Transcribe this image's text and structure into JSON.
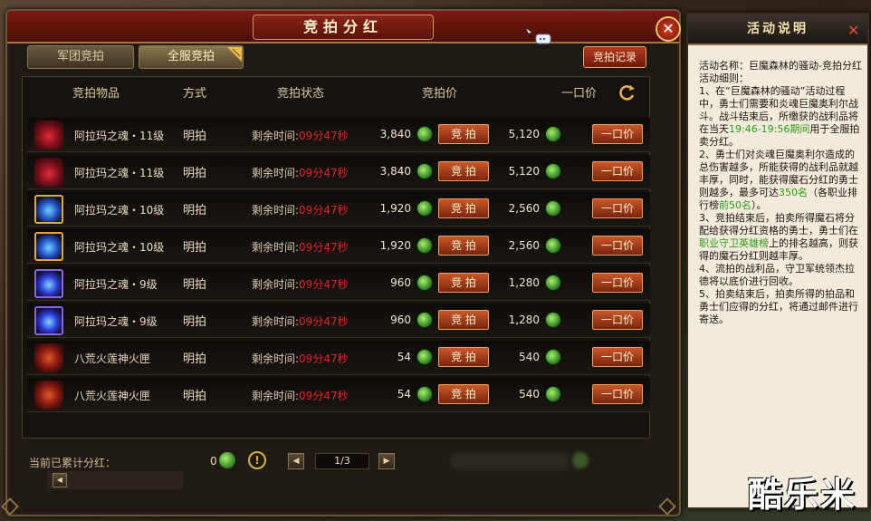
{
  "window": {
    "title": "竞拍分红",
    "close_label": "✕"
  },
  "tabs": [
    {
      "label": "军团竞拍"
    },
    {
      "label": "全服竞拍"
    }
  ],
  "record_button": "竞拍记录",
  "headers": {
    "item": "竞拍物品",
    "mode": "方式",
    "status": "竞拍状态",
    "bid_price": "竞拍价",
    "buyout_price": "一口价"
  },
  "rows": [
    {
      "name": "阿拉玛之魂・11级",
      "mode": "明拍",
      "time_label": "剩余时间:",
      "time": "09分47秒",
      "bid": "3,840",
      "bid_btn": "竞 拍",
      "buyout": "5,120",
      "buyout_btn": "一口价",
      "icon": "red-soul-icon"
    },
    {
      "name": "阿拉玛之魂・11级",
      "mode": "明拍",
      "time_label": "剩余时间:",
      "time": "09分47秒",
      "bid": "3,840",
      "bid_btn": "竞 拍",
      "buyout": "5,120",
      "buyout_btn": "一口价",
      "icon": "red-soul-icon"
    },
    {
      "name": "阿拉玛之魂・10级",
      "mode": "明拍",
      "time_label": "剩余时间:",
      "time": "09分47秒",
      "bid": "1,920",
      "bid_btn": "竞 拍",
      "buyout": "2,560",
      "buyout_btn": "一口价",
      "icon": "gold-soul-icon"
    },
    {
      "name": "阿拉玛之魂・10级",
      "mode": "明拍",
      "time_label": "剩余时间:",
      "time": "09分47秒",
      "bid": "1,920",
      "bid_btn": "竞 拍",
      "buyout": "2,560",
      "buyout_btn": "一口价",
      "icon": "gold-soul-icon"
    },
    {
      "name": "阿拉玛之魂・9级",
      "mode": "明拍",
      "time_label": "剩余时间:",
      "time": "09分47秒",
      "bid": "960",
      "bid_btn": "竞 拍",
      "buyout": "1,280",
      "buyout_btn": "一口价",
      "icon": "purple-soul-icon"
    },
    {
      "name": "阿拉玛之魂・9级",
      "mode": "明拍",
      "time_label": "剩余时间:",
      "time": "09分47秒",
      "bid": "960",
      "bid_btn": "竞 拍",
      "buyout": "1,280",
      "buyout_btn": "一口价",
      "icon": "purple-soul-icon"
    },
    {
      "name": "八荒火莲神火匣",
      "mode": "明拍",
      "time_label": "剩余时间:",
      "time": "09分47秒",
      "bid": "54",
      "bid_btn": "竞 拍",
      "buyout": "540",
      "buyout_btn": "一口价",
      "icon": "fire-box-icon"
    },
    {
      "name": "八荒火莲神火匣",
      "mode": "明拍",
      "time_label": "剩余时间:",
      "time": "09分47秒",
      "bid": "54",
      "bid_btn": "竞 拍",
      "buyout": "540",
      "buyout_btn": "一口价",
      "icon": "fire-box-icon"
    }
  ],
  "footer": {
    "total_label": "当前已累计分红：",
    "total_value": "0",
    "page": "1/3"
  },
  "side": {
    "title": "活动说明",
    "close_label": "✕",
    "paragraphs": [
      "活动名称：巨魔森林的骚动-竞拍分红",
      "活动细则：",
      "1、在“巨魔森林的骚动”活动过程中，勇士们需要和炎魂巨魔奥利尔战斗。战斗结束后，所缴获的战利品将在当天",
      "19:46-19:56期间",
      "用于全服拍卖分红。",
      "2、勇士们对炎魂巨魔奥利尔造成的总伤害越多，所能获得的战利品就越丰厚，同时，能获得魔石分红的勇士则越多，最多可达",
      "350名",
      "（各职业排行榜",
      "前50名",
      "）。",
      "3、竞拍结束后，拍卖所得魔石将分配给获得分红资格的勇士，勇士们在",
      "职业守卫英雄榜",
      "上的排名越高，则获得的魔石分红则越丰厚。",
      "4、流拍的战利品，守卫军统领杰拉德将以底价进行回收。",
      "5、拍卖结束后，拍卖所得的拍品和勇士们应得的分红，将通过邮件进行寄送。"
    ]
  },
  "watermark": "酷乐米",
  "colors": {
    "accent_red": "#e0282a",
    "highlight_green": "#2e9a1a",
    "button": "#c8582a"
  }
}
